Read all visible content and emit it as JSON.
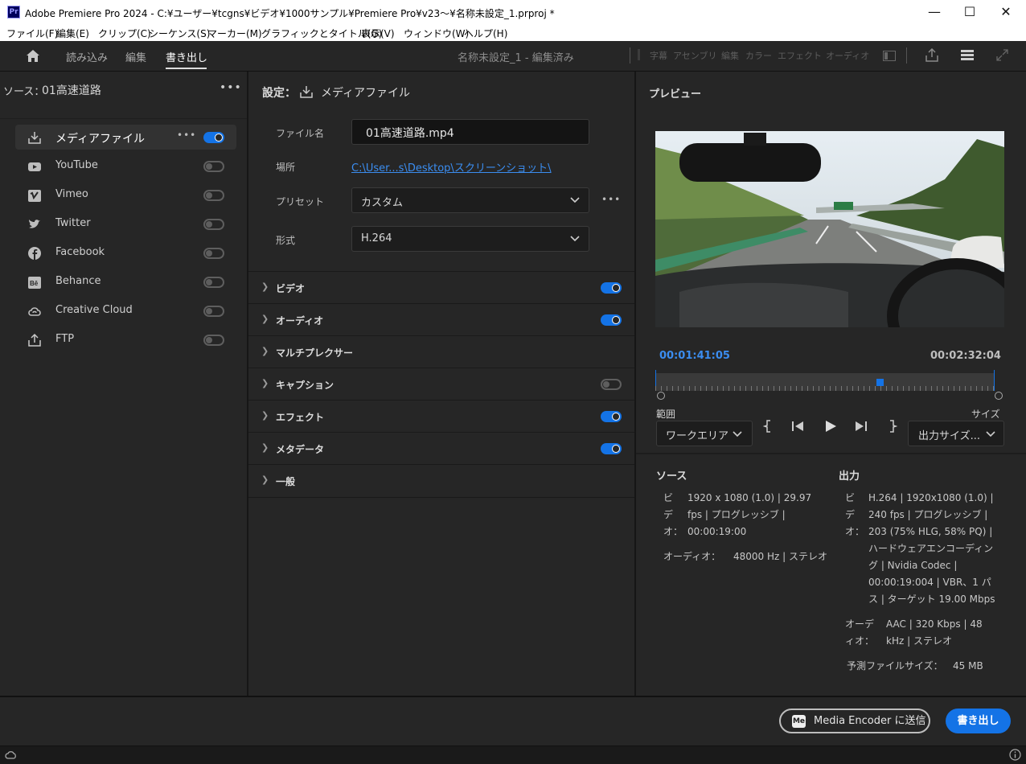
{
  "window": {
    "app_icon": "Pr",
    "title": "Adobe Premiere Pro 2024 - C:¥ユーザー¥tcgns¥ビデオ¥1000サンプル¥Premiere Pro¥v23～¥名称未設定_1.prproj *",
    "minimize": "—",
    "maximize": "☐",
    "close": "✕"
  },
  "menu": [
    "ファイル(F)",
    "編集(E)",
    "クリップ(C)",
    "シーケンス(S)",
    "マーカー(M)",
    "グラフィックとタイトル(G)",
    "表示(V)",
    "ウィンドウ(W)",
    "ヘルプ(H)"
  ],
  "header": {
    "tabs": [
      "読み込み",
      "編集",
      "書き出し"
    ],
    "active_tab": "書き出し",
    "project_title": "名称未設定_1 - 編集済み",
    "workspaces": [
      "字幕",
      "アセンブリ",
      "編集",
      "カラー",
      "エフェクト",
      "オーディオ"
    ]
  },
  "source": {
    "label": "ソース：",
    "name": "01高速道路"
  },
  "destinations": [
    {
      "label": "メディアファイル",
      "icon": "download-icon",
      "on": true
    },
    {
      "label": "YouTube",
      "icon": "youtube-icon",
      "on": false
    },
    {
      "label": "Vimeo",
      "icon": "vimeo-icon",
      "on": false
    },
    {
      "label": "Twitter",
      "icon": "twitter-icon",
      "on": false
    },
    {
      "label": "Facebook",
      "icon": "facebook-icon",
      "on": false
    },
    {
      "label": "Behance",
      "icon": "behance-icon",
      "on": false
    },
    {
      "label": "Creative Cloud",
      "icon": "creative-cloud-icon",
      "on": false
    },
    {
      "label": "FTP",
      "icon": "upload-icon",
      "on": false
    }
  ],
  "settings": {
    "heading": "設定：",
    "heading_target": "メディアファイル",
    "filename_label": "ファイル名",
    "filename_value": "01高速道路.mp4",
    "location_label": "場所",
    "location_value": "C:\\User...s\\Desktop\\スクリーンショット\\",
    "preset_label": "プリセット",
    "preset_value": "カスタム",
    "format_label": "形式",
    "format_value": "H.264",
    "sections": [
      {
        "label": "ビデオ",
        "toggle": "on"
      },
      {
        "label": "オーディオ",
        "toggle": "on"
      },
      {
        "label": "マルチプレクサー",
        "toggle": "none"
      },
      {
        "label": "キャプション",
        "toggle": "off"
      },
      {
        "label": "エフェクト",
        "toggle": "on"
      },
      {
        "label": "メタデータ",
        "toggle": "on"
      },
      {
        "label": "一般",
        "toggle": "none"
      }
    ]
  },
  "preview": {
    "heading": "プレビュー",
    "current_time": "00:01:41:05",
    "duration": "00:02:32:04",
    "playhead_fraction": 0.66,
    "range_label": "範囲",
    "range_value": "ワークエリア",
    "size_label": "サイズ",
    "size_value": "出力サイズ..."
  },
  "summary": {
    "source_heading": "ソース",
    "output_heading": "出力",
    "video_label": "ビデオ：",
    "audio_label": "オーディオ：",
    "source_video": "1920 x 1080 (1.0) | 29.97 fps | プログレッシブ | 00:00:19:00",
    "source_audio": "48000 Hz | ステレオ",
    "output_video": "H.264 | 1920x1080 (1.0) | 240 fps | プログレッシブ | 203 (75% HLG, 58% PQ) | ハードウェアエンコーディング | Nvidia Codec | 00:00:19:004 | VBR、1 パス | ターゲット 19.00 Mbps",
    "output_audio": "AAC | 320 Kbps | 48 kHz | ステレオ",
    "est_size_label": "予測ファイルサイズ：",
    "est_size_value": "45 MB"
  },
  "footer": {
    "media_encoder_icon": "Me",
    "media_encoder_button": "Media Encoder に送信",
    "export_button": "書き出し"
  },
  "colors": {
    "accent": "#1473e6",
    "timecode": "#3b8df0",
    "link": "#3b8df0"
  }
}
